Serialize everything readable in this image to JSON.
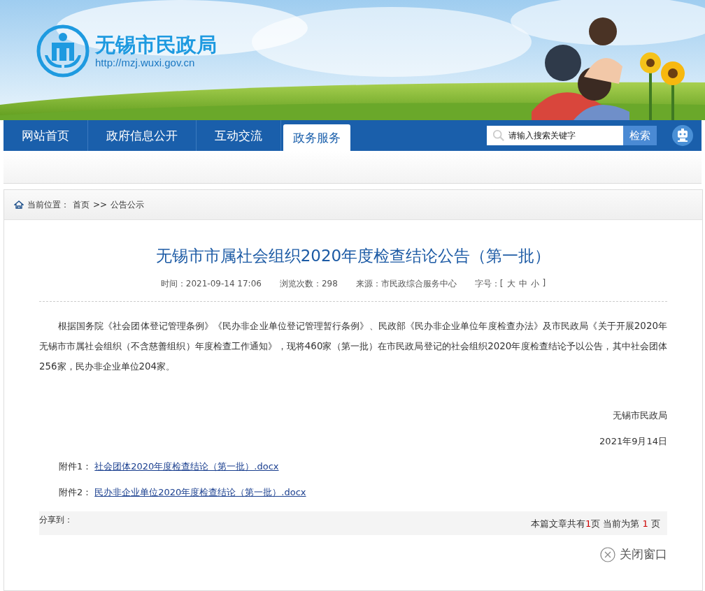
{
  "header": {
    "site_name": "无锡市民政局",
    "url": "http://mzj.wuxi.gov.cn"
  },
  "nav": {
    "tabs": [
      {
        "label": "网站首页",
        "selected": false
      },
      {
        "label": "政府信息公开",
        "selected": false
      },
      {
        "label": "互动交流",
        "selected": false
      },
      {
        "label": "政务服务",
        "selected": true
      }
    ],
    "search": {
      "placeholder": "请输入搜索关键字",
      "button": "检索"
    }
  },
  "breadcrumb": {
    "label": "当前位置：",
    "items": [
      "首页",
      "公告公示"
    ],
    "separator": ">>"
  },
  "article": {
    "title": "无锡市市属社会组织2020年度检查结论公告（第一批）",
    "meta": [
      {
        "label": "时间：",
        "value": "2021-09-14 17:06"
      },
      {
        "label": "浏览次数：",
        "value": "298"
      },
      {
        "label": "来源：",
        "value": "市民政综合服务中心"
      }
    ],
    "font_size": {
      "label": "字号：[",
      "options": [
        "大",
        "中",
        "小"
      ],
      "end": "]"
    },
    "body": "根据国务院《社会团体登记管理条例》《民办非企业单位登记管理暂行条例》、民政部《民办非企业单位年度检查办法》及市民政局《关于开展2020年无锡市市属社会组织（不含慈善组织）年度检查工作通知》，现将460家（第一批）在市民政局登记的社会组织2020年度检查结论予以公告，其中社会团体256家，民办非企业单位204家。",
    "signature": "无锡市民政局",
    "date": "2021年9月14日",
    "attachments": [
      {
        "label": "附件1：",
        "link": "社会团体2020年度检查结论（第一批）.docx"
      },
      {
        "label": "附件2：",
        "link": "民办非企业单位2020年度检查结论（第一批）.docx"
      }
    ],
    "share": "分享到：",
    "pager": {
      "prefix": "本篇文章共有",
      "total": "1",
      "middle": "页 当前为第",
      "current": "1",
      "suffix": "页"
    },
    "close": "关闭窗口"
  }
}
